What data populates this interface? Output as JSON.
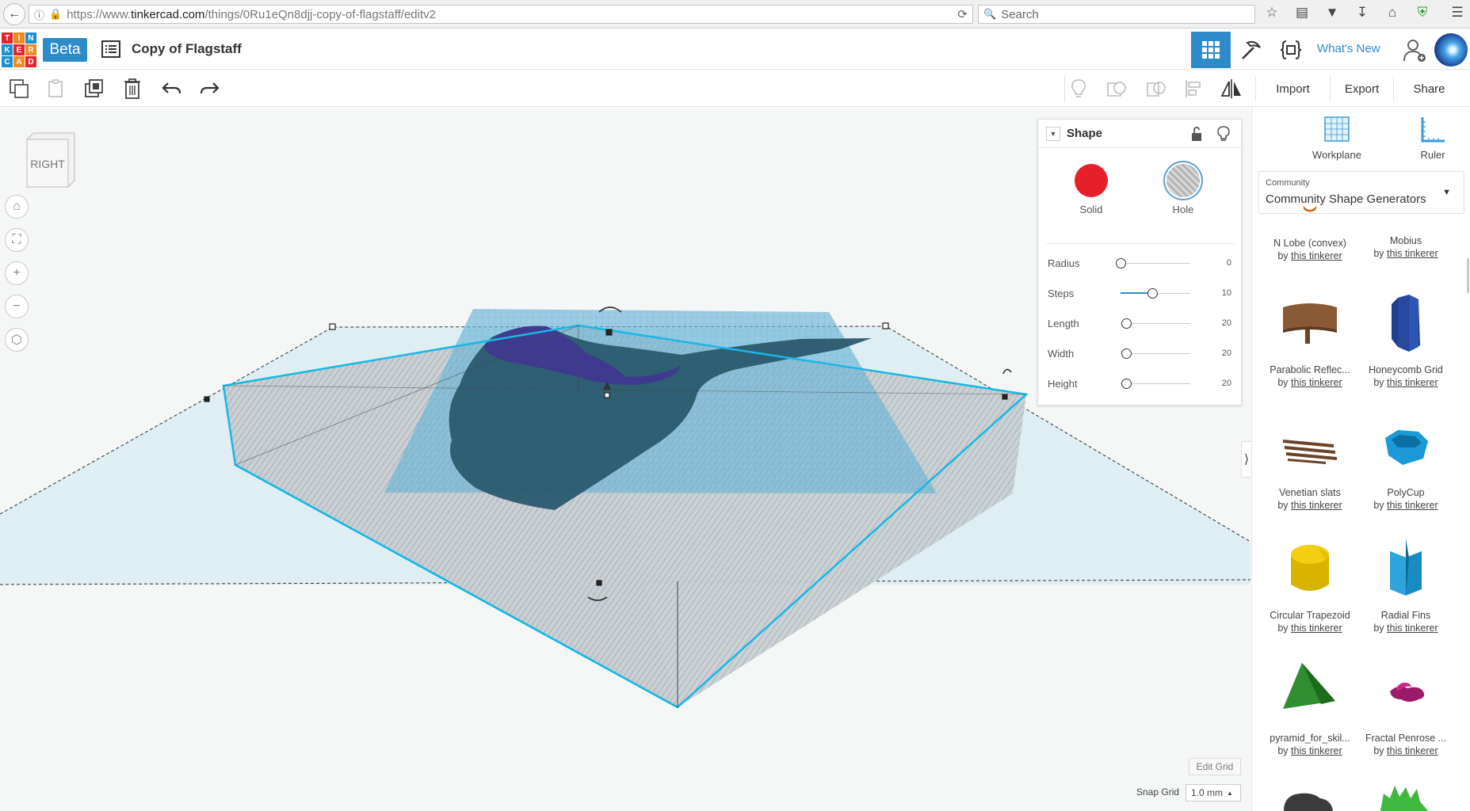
{
  "browser": {
    "url_prefix": "https://www.",
    "url_domain": "tinkercad.com",
    "url_path": "/things/0Ru1eQn8djj-copy-of-flagstaff/editv2",
    "search_placeholder": "Search"
  },
  "header": {
    "logo_letters": [
      "T",
      "I",
      "N",
      "K",
      "E",
      "R",
      "C",
      "A",
      "D"
    ],
    "beta_label": "Beta",
    "design_title": "Copy of Flagstaff",
    "whats_new": "What's New"
  },
  "toolbar": {
    "import_label": "Import",
    "export_label": "Export",
    "share_label": "Share"
  },
  "viewport": {
    "view_cube_label": "RIGHT",
    "edit_grid_label": "Edit Grid",
    "snap_grid_label": "Snap Grid",
    "snap_grid_value": "1.0 mm"
  },
  "shape_panel": {
    "title": "Shape",
    "solid_label": "Solid",
    "hole_label": "Hole",
    "solid_color": "#e8202c",
    "selected": "Hole",
    "params": [
      {
        "label": "Radius",
        "value": "0",
        "fraction": 0.0
      },
      {
        "label": "Steps",
        "value": "10",
        "fraction": 0.4
      },
      {
        "label": "Length",
        "value": "20",
        "fraction": 0.07
      },
      {
        "label": "Width",
        "value": "20",
        "fraction": 0.07
      },
      {
        "label": "Height",
        "value": "20",
        "fraction": 0.07
      }
    ]
  },
  "sidebar": {
    "workplane_label": "Workplane",
    "ruler_label": "Ruler",
    "library_small": "Community",
    "library_name": "Community Shape Generators",
    "by_prefix": "by",
    "author": "this tinkerer",
    "shapes": [
      {
        "name": "N Lobe (convex)",
        "icon": "n-lobe-thumb"
      },
      {
        "name": "Mobius",
        "icon": "mobius-thumb"
      },
      {
        "name": "Parabolic Reflec...",
        "icon": "parabolic-reflector-thumb"
      },
      {
        "name": "Honeycomb Grid",
        "icon": "honeycomb-grid-thumb"
      },
      {
        "name": "Venetian slats",
        "icon": "venetian-slats-thumb"
      },
      {
        "name": "PolyCup",
        "icon": "polycup-thumb"
      },
      {
        "name": "Circular Trapezoid",
        "icon": "circular-trapezoid-thumb"
      },
      {
        "name": "Radial Fins",
        "icon": "radial-fins-thumb"
      },
      {
        "name": "pyramid_for_skil...",
        "icon": "pyramid-thumb"
      },
      {
        "name": "Fractal Penrose ...",
        "icon": "fractal-penrose-thumb"
      }
    ]
  }
}
